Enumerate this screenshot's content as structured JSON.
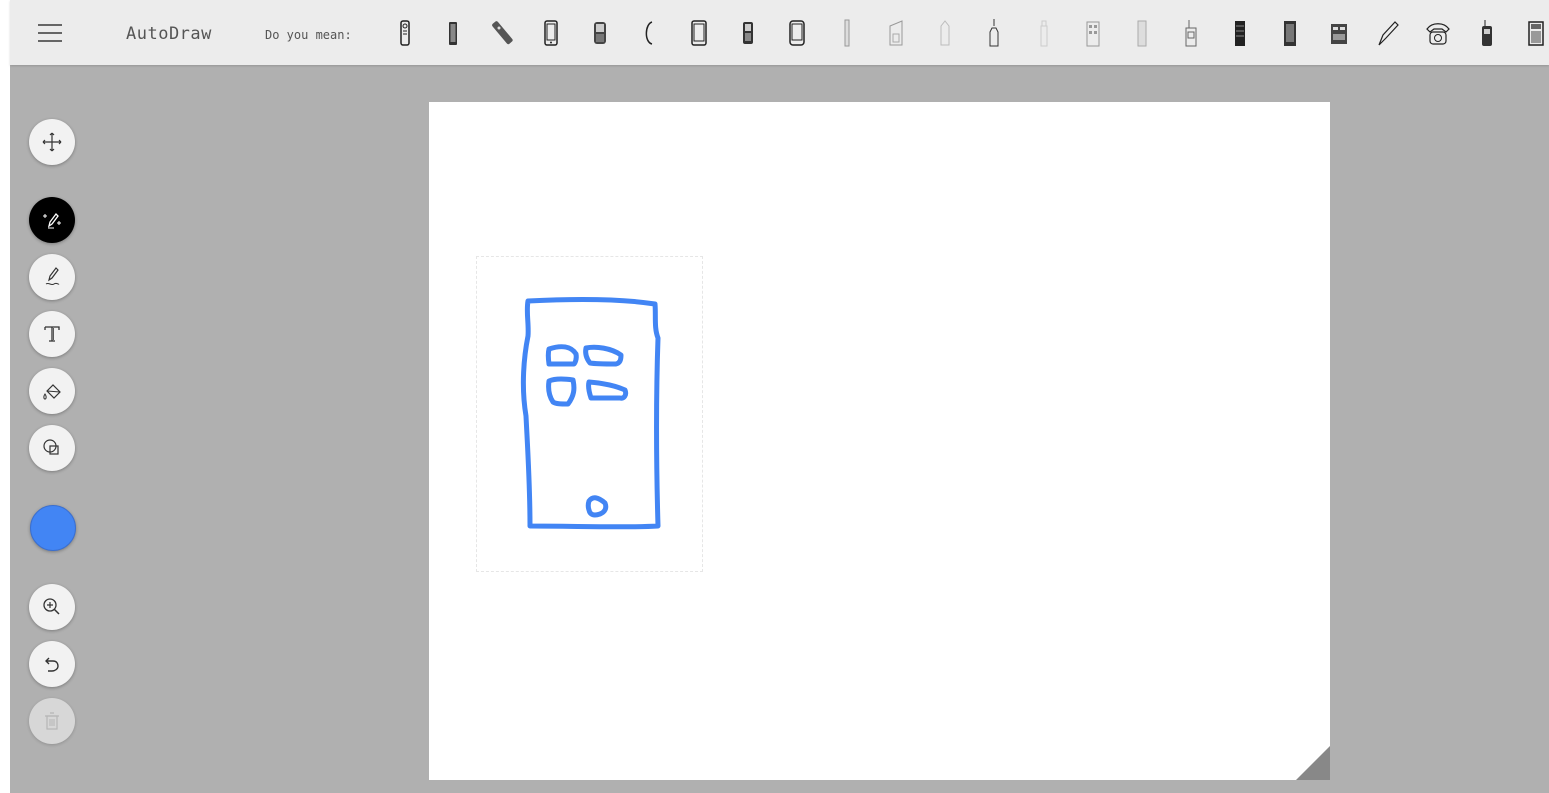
{
  "app": {
    "title": "AutoDraw"
  },
  "topbar": {
    "hint_label": "Do you mean:",
    "suggestions": [
      "remote-control-icon",
      "walkie-talkie-icon",
      "tv-remote-icon",
      "smartphone-icon",
      "flip-phone-icon",
      "telephone-handset-icon",
      "tablet-phone-icon",
      "feature-phone-icon",
      "mobile-device-icon",
      "tall-building-icon",
      "office-building-icon",
      "tower-icon",
      "skyscraper-spire-icon",
      "lighthouse-tower-icon",
      "apartment-building-icon",
      "high-rise-icon",
      "radio-tower-icon",
      "server-rack-icon",
      "city-building-icon",
      "building-block-icon",
      "pen-nib-icon",
      "rotary-telephone-icon",
      "walkie-talkie-2-icon",
      "calculator-icon"
    ]
  },
  "tools": {
    "items": [
      {
        "name": "move-tool",
        "icon": "move-arrows-icon"
      },
      {
        "name": "autodraw-tool",
        "icon": "autodraw-pen-icon",
        "active": true
      },
      {
        "name": "draw-tool",
        "icon": "pencil-icon"
      },
      {
        "name": "type-tool",
        "icon": "text-T-icon"
      },
      {
        "name": "fill-tool",
        "icon": "paint-bucket-icon"
      },
      {
        "name": "shape-tool",
        "icon": "shapes-icon"
      }
    ],
    "color": "#4285f4",
    "actions": [
      {
        "name": "zoom-in-button",
        "icon": "zoom-in-icon"
      },
      {
        "name": "undo-button",
        "icon": "undo-icon"
      },
      {
        "name": "delete-button",
        "icon": "trash-icon",
        "disabled": true
      }
    ]
  },
  "canvas": {
    "stroke_color": "#4285f4",
    "background": "#ffffff"
  }
}
